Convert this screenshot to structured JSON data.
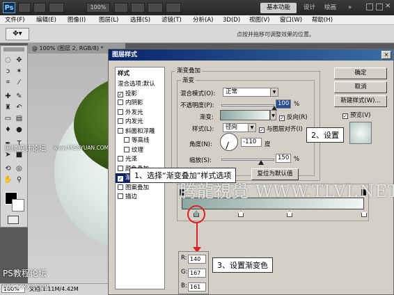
{
  "app": {
    "logo": "Ps",
    "zoom_value": "100%",
    "workspace": "基本功能",
    "workspace_others": [
      "设计",
      "绘画"
    ]
  },
  "menubar": [
    "文件(F)",
    "编辑(E)",
    "图像(I)",
    "图层(L)",
    "选择(S)",
    "滤镜(T)",
    "分析(A)",
    "3D(D)",
    "视图(V)",
    "窗口(W)",
    "帮助(H)"
  ],
  "options_bar": {
    "hint": "点按并拖移可调整效果的位置。"
  },
  "document": {
    "tab": "@ 100% (图层 2, RGB/8) *",
    "zoom": "100%",
    "doc_size": "文档:1.11M/4.42M"
  },
  "watermarks": {
    "forum": "思缘设计论坛",
    "url": "www.MISSYUAN.COM",
    "site": "PS教程论坛",
    "site_small": "BBS.16XX8.COM",
    "brand": "腾龍視覺 WWW.TLVI.NET"
  },
  "dialog": {
    "title": "图层样式",
    "close": "×",
    "styles_header": "样式",
    "styles": [
      {
        "label": "混合选项:默认",
        "checkbox": false
      },
      {
        "label": "投影",
        "checkbox": true,
        "checked": true
      },
      {
        "label": "内阴影",
        "checkbox": true,
        "checked": false
      },
      {
        "label": "外发光",
        "checkbox": true,
        "checked": false
      },
      {
        "label": "内发光",
        "checkbox": true,
        "checked": false
      },
      {
        "label": "斜面和浮雕",
        "checkbox": true,
        "checked": false
      },
      {
        "label": "等高线",
        "checkbox": true,
        "checked": false,
        "indent": true
      },
      {
        "label": "纹理",
        "checkbox": true,
        "checked": false,
        "indent": true
      },
      {
        "label": "光泽",
        "checkbox": true,
        "checked": false
      },
      {
        "label": "颜色叠加",
        "checkbox": true,
        "checked": false
      },
      {
        "label": "渐变叠加",
        "checkbox": true,
        "checked": true,
        "selected": true
      },
      {
        "label": "图案叠加",
        "checkbox": true,
        "checked": false
      },
      {
        "label": "描边",
        "checkbox": true,
        "checked": false
      }
    ],
    "section_title": "渐变叠加",
    "group_title": "渐变",
    "blend_mode_label": "混合模式(O):",
    "blend_mode_value": "正常",
    "opacity_label": "不透明度(P):",
    "opacity_value": "100",
    "opacity_fraction": 1.0,
    "percent": "%",
    "gradient_label": "渐变:",
    "reverse_label": "反向(R)",
    "reverse_checked": true,
    "style_label": "样式(L):",
    "style_value": "径向",
    "align_label": "与图层对齐(I)",
    "align_checked": true,
    "angle_label": "角度(N):",
    "angle_value": "-110",
    "degree_unit": "度",
    "scale_label": "缩放(S):",
    "scale_value": "150",
    "reset_button": "复位为默认值",
    "buttons": {
      "ok": "确定",
      "cancel": "取消",
      "new_style": "新建样式(W)...",
      "preview": "预览(V)"
    },
    "preview_checked": true,
    "rgb": {
      "r_label": "R:",
      "r": "140",
      "g_label": "G:",
      "g": "167",
      "b_label": "B:",
      "b": "161"
    }
  },
  "callouts": {
    "step1": "1、选择“渐变叠加”样式选项",
    "step2": "2、设置",
    "step3": "3、设置渐变色"
  },
  "colors": {
    "accent_red": "#e02020",
    "selection_blue": "#0a246a",
    "gradient_start": "#8ca7a1",
    "gradient_end": "#f2f6f5"
  }
}
